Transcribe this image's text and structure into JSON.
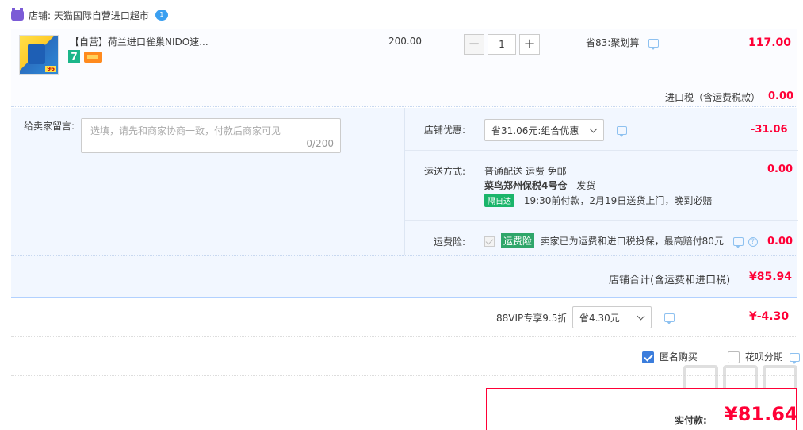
{
  "shop": {
    "label": "店铺: 天猫国际自营进口超市",
    "wang_badge": "1"
  },
  "item": {
    "title": "【自营】荷兰进口雀巢NIDO速...",
    "badge_seven": "7",
    "thumb_tag": "96",
    "price": "200.00",
    "quantity": "1",
    "qty_minus": "−",
    "qty_plus": "+",
    "promo": "省83:聚划算",
    "subtotal": "117.00",
    "tax_label": "进口税（含运费税款）",
    "tax_value": "0.00"
  },
  "message": {
    "label": "给卖家留言:",
    "placeholder": "选填，请先和商家协商一致，付款后商家可见",
    "count": "0/200"
  },
  "shop_discount": {
    "label": "店铺优惠:",
    "selected": "省31.06元:组合优惠",
    "value": "-31.06"
  },
  "shipping": {
    "label": "运送方式:",
    "line1": "普通配送 运费 免邮",
    "warehouse": "菜鸟郑州保税4号仓",
    "dispatch": "发货",
    "badge": "隔日达",
    "eta": "19:30前付款，2月19日送货上门，晚到必赔",
    "value": "0.00"
  },
  "insurance": {
    "label": "运费险:",
    "tag": "运费险",
    "desc": "卖家已为运费和进口税投保，最高赔付80元",
    "value": "0.00"
  },
  "shop_total": {
    "label": "店铺合计(含运费和进口税)",
    "value": "¥85.94"
  },
  "vip": {
    "label": "88VIP专享9.5折",
    "selected": "省4.30元",
    "value": "¥-4.30"
  },
  "options": {
    "anonymous": "匿名购买",
    "huabei": "花呗分期"
  },
  "payment": {
    "label": "实付款:",
    "value": "¥81.64"
  },
  "colors": {
    "accent_red": "#ff0036",
    "border_blue": "#b2d1ff",
    "panel_bg": "#f2f7ff"
  }
}
